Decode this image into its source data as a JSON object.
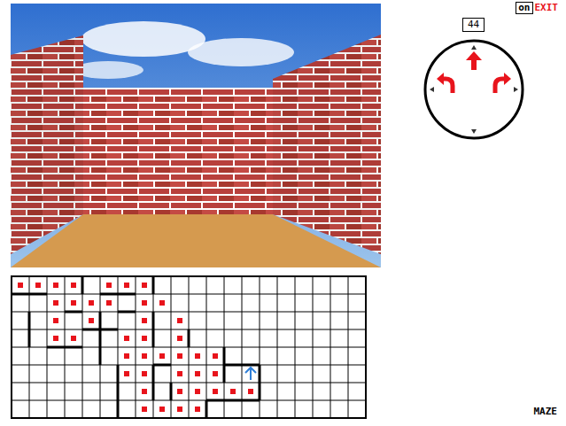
{
  "top_bar": {
    "toggle": "on",
    "exit": "EXIT"
  },
  "compass": {
    "steps": "44"
  },
  "map": {
    "columns": 20,
    "rows": 8,
    "visited": [
      [
        0,
        0
      ],
      [
        1,
        0
      ],
      [
        2,
        0
      ],
      [
        3,
        0
      ],
      [
        5,
        0
      ],
      [
        6,
        0
      ],
      [
        7,
        0
      ],
      [
        2,
        1
      ],
      [
        3,
        1
      ],
      [
        4,
        1
      ],
      [
        5,
        1
      ],
      [
        7,
        1
      ],
      [
        8,
        1
      ],
      [
        2,
        2
      ],
      [
        4,
        2
      ],
      [
        7,
        2
      ],
      [
        9,
        2
      ],
      [
        2,
        3
      ],
      [
        3,
        3
      ],
      [
        6,
        3
      ],
      [
        7,
        3
      ],
      [
        9,
        3
      ],
      [
        6,
        4
      ],
      [
        7,
        4
      ],
      [
        8,
        4
      ],
      [
        9,
        4
      ],
      [
        10,
        4
      ],
      [
        11,
        4
      ],
      [
        6,
        5
      ],
      [
        7,
        5
      ],
      [
        9,
        5
      ],
      [
        10,
        5
      ],
      [
        11,
        5
      ],
      [
        7,
        6
      ],
      [
        9,
        6
      ],
      [
        10,
        6
      ],
      [
        11,
        6
      ],
      [
        12,
        6
      ],
      [
        13,
        6
      ],
      [
        7,
        7
      ],
      [
        8,
        7
      ],
      [
        9,
        7
      ],
      [
        10,
        7
      ]
    ],
    "walls": [
      [
        0,
        1,
        2,
        1
      ],
      [
        4,
        0,
        4,
        1
      ],
      [
        5,
        1,
        7,
        1
      ],
      [
        8,
        0,
        8,
        1
      ],
      [
        1,
        2,
        1,
        4
      ],
      [
        2,
        4,
        4,
        4
      ],
      [
        3,
        2,
        4,
        2
      ],
      [
        4,
        3,
        6,
        3
      ],
      [
        5,
        2,
        5,
        5
      ],
      [
        6,
        2,
        7,
        2
      ],
      [
        8,
        2,
        8,
        4
      ],
      [
        6,
        5,
        6,
        8
      ],
      [
        8,
        5,
        9,
        5
      ],
      [
        8,
        5,
        8,
        7
      ],
      [
        10,
        3,
        10,
        4
      ],
      [
        9,
        6,
        9,
        7
      ],
      [
        12,
        4,
        12,
        6
      ],
      [
        11,
        7,
        14,
        7
      ],
      [
        14,
        5,
        14,
        7
      ],
      [
        12,
        5,
        14,
        5
      ],
      [
        11,
        8,
        11,
        7
      ]
    ],
    "player": {
      "col": 13,
      "row": 5
    }
  },
  "footer": {
    "title": "MAZE"
  }
}
